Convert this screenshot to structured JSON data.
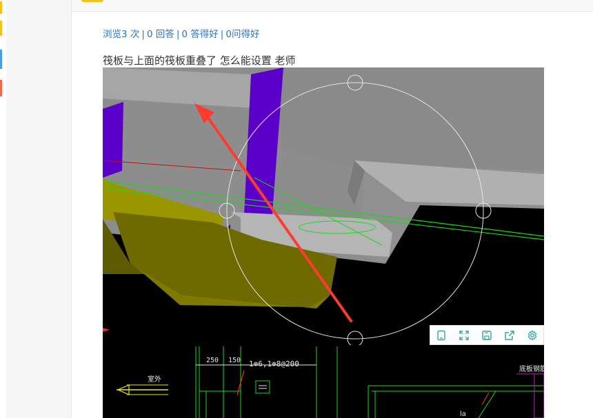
{
  "stats": {
    "views": "浏览3 次",
    "answers": "0 回答",
    "good_answers": "0 答得好",
    "good_questions": "0问得好",
    "separator": "|"
  },
  "question": {
    "title": "筏板与上面的筏板重叠了 怎么能设置 老师"
  },
  "image": {
    "cad_dim_1": "250",
    "cad_dim_2": "150",
    "cad_rebar": "1⊕6,1⊕8@200",
    "cad_outside": "室外",
    "cad_bottom_rebar": "底板钢筋",
    "cad_la": "la"
  },
  "image_toolbar": {
    "icons": [
      "tablet-icon",
      "fullscreen-icon",
      "save-icon",
      "share-icon",
      "settings-icon"
    ]
  },
  "colors": {
    "link": "#2a72c2",
    "text": "#333333",
    "accent_yellow": "#f3c21e",
    "toolbar_icon": "#2fa2a0"
  }
}
